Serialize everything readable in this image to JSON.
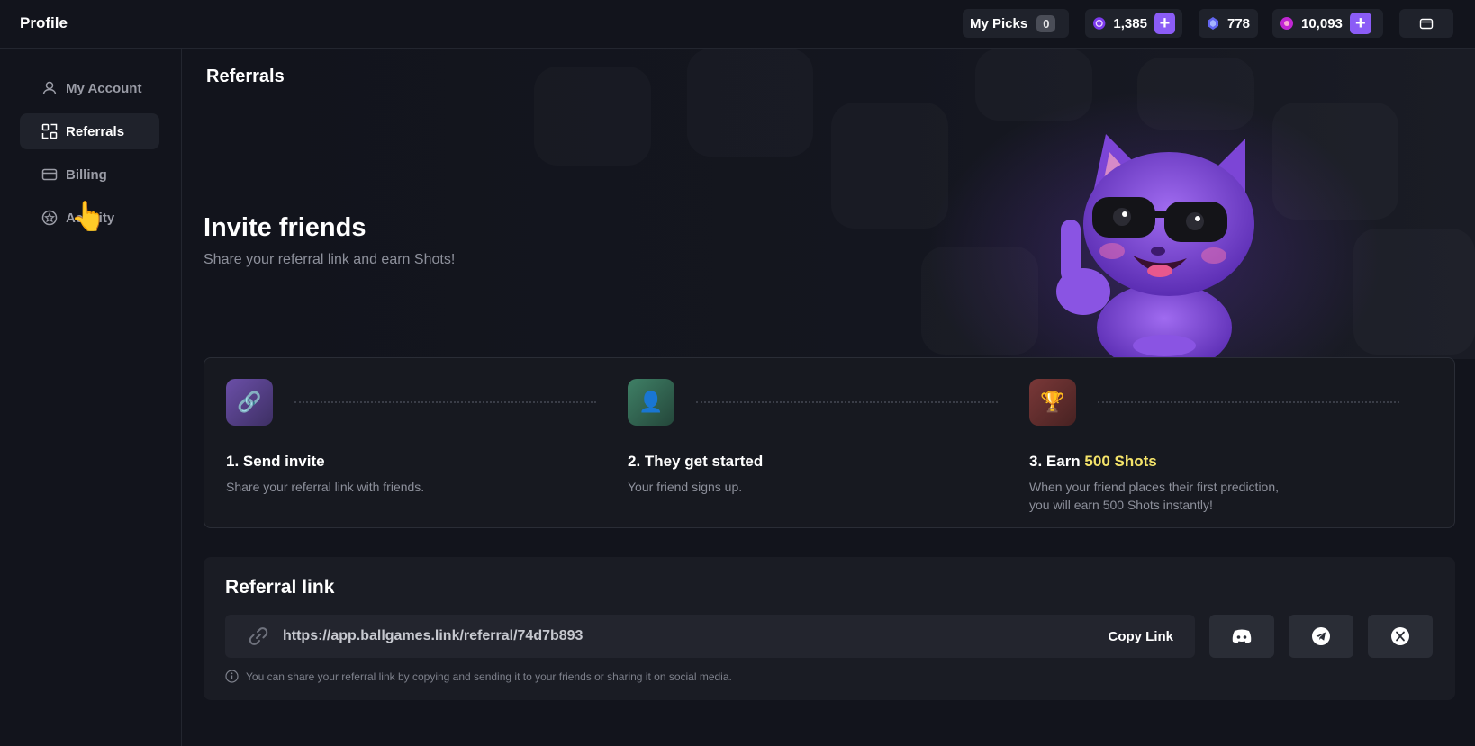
{
  "header": {
    "title": "Profile",
    "my_picks_label": "My Picks",
    "my_picks_count": "0",
    "balance_1": "1,385",
    "balance_2": "778",
    "balance_3": "10,093",
    "plus_label": "+"
  },
  "sidebar": {
    "items": [
      {
        "label": "My Account",
        "icon": "user-icon"
      },
      {
        "label": "Referrals",
        "icon": "referral-icon"
      },
      {
        "label": "Billing",
        "icon": "card-icon"
      },
      {
        "label": "Activity",
        "icon": "star-circle-icon"
      }
    ],
    "active": "Referrals"
  },
  "main": {
    "section_title": "Referrals",
    "hero": {
      "heading": "Invite friends",
      "subheading": "Share your referral link and earn Shots!"
    },
    "steps": [
      {
        "icon": "🔗",
        "title": "1. Send invite",
        "desc": "Share your referral link with friends."
      },
      {
        "icon": "👤",
        "title": "2. They get started",
        "desc": "Your friend signs up."
      },
      {
        "icon": "🏆",
        "title_prefix": "3. Earn ",
        "title_highlight": "500 Shots",
        "desc": "When your friend places their first prediction, you will earn 500 Shots instantly!"
      }
    ],
    "referral": {
      "title": "Referral link",
      "link": "https://app.ballgames.link/referral/74d7b893",
      "copy_label": "Copy Link",
      "info": "You can share your referral link by copying and sending it to your friends or sharing it on social media."
    }
  },
  "colors": {
    "accent": "#8b5cf6",
    "highlight": "#f5e46a",
    "background": "#12141c"
  }
}
